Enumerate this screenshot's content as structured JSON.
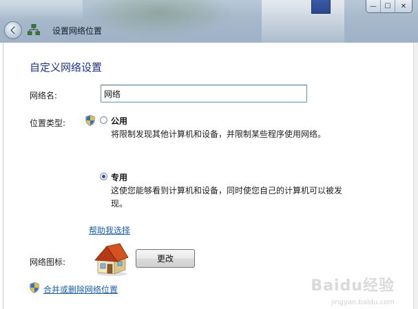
{
  "window": {
    "title": "设置网络位置",
    "buttons": {
      "minimize": "—",
      "maximize": "☐",
      "close": "✕"
    }
  },
  "main": {
    "heading": "自定义网络设置",
    "network_name": {
      "label": "网络名:",
      "value": "网络"
    },
    "location_type": {
      "label": "位置类型:",
      "options": [
        {
          "title": "公用",
          "description": "将限制发现其他计算机和设备，并限制某些程序使用网络。",
          "selected": false
        },
        {
          "title": "专用",
          "description_line1": "这使您能够看到计算机和设备，同时使您自己的计算机可以被发",
          "description_line2": "现。",
          "selected": true
        }
      ]
    },
    "help_link": "帮助我选择",
    "network_icon": {
      "label": "网络图标:",
      "change_button": "更改"
    },
    "merge_link": "合并或删除网络位置"
  },
  "watermark": {
    "text": "Baidu经验",
    "sub": "jingyan.baidu.com"
  },
  "icons": [
    "back-arrow-icon",
    "network-icon",
    "shield-icon",
    "house-icon"
  ]
}
